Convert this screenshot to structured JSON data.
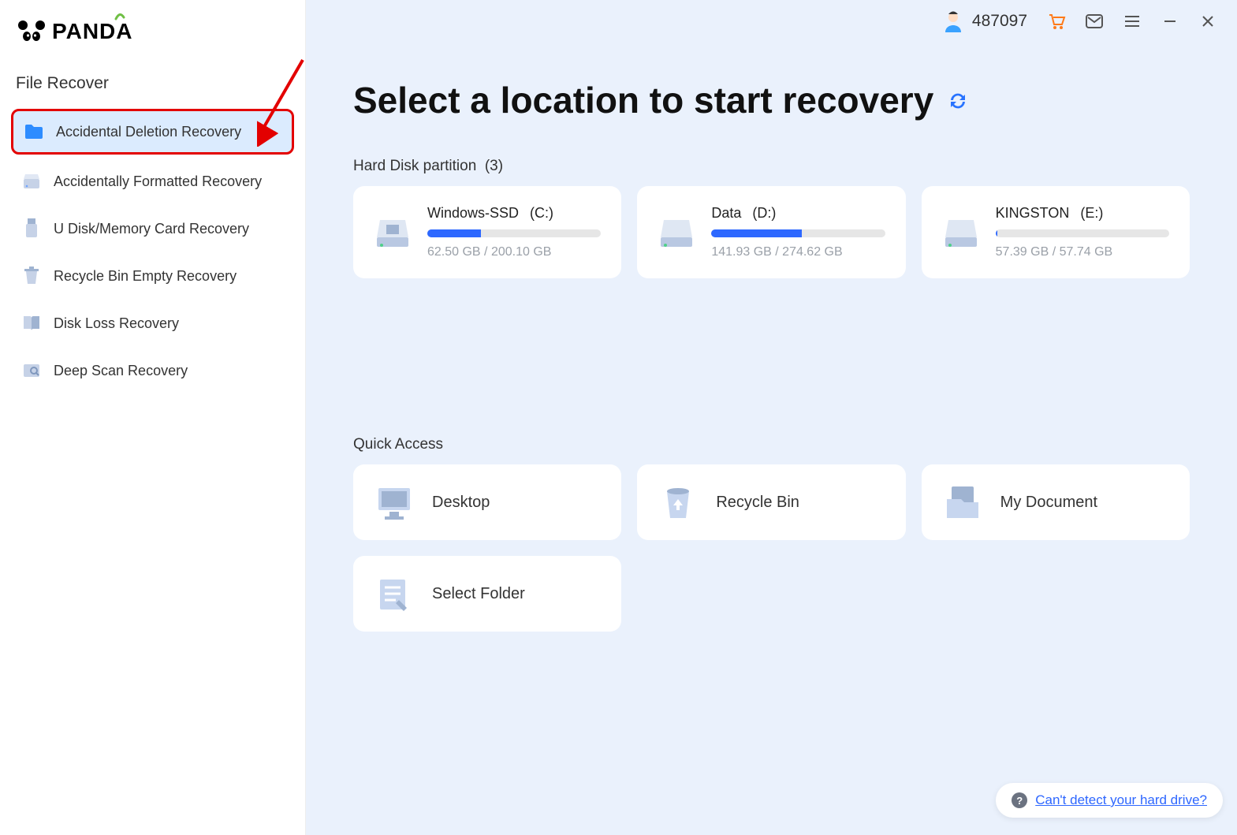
{
  "brand": {
    "name": "PANDA"
  },
  "sidebar": {
    "heading": "File Recover",
    "items": [
      {
        "label": "Accidental Deletion Recovery",
        "icon": "folder-icon",
        "active": true
      },
      {
        "label": "Accidentally Formatted Recovery",
        "icon": "drive-icon",
        "active": false
      },
      {
        "label": "U Disk/Memory Card Recovery",
        "icon": "usb-icon",
        "active": false
      },
      {
        "label": "Recycle Bin Empty Recovery",
        "icon": "trash-icon",
        "active": false
      },
      {
        "label": "Disk Loss Recovery",
        "icon": "book-icon",
        "active": false
      },
      {
        "label": "Deep Scan Recovery",
        "icon": "scan-icon",
        "active": false
      }
    ]
  },
  "titlebar": {
    "user_id": "487097"
  },
  "main": {
    "title": "Select a location to start recovery",
    "partitions_label": "Hard Disk partition",
    "partitions_count": "(3)",
    "partitions": [
      {
        "name": "Windows-SSD",
        "letter": "(C:)",
        "used": "62.50 GB",
        "total": "200.10 GB",
        "size_text": "62.50 GB / 200.10 GB",
        "percent": 31
      },
      {
        "name": "Data",
        "letter": "(D:)",
        "used": "141.93 GB",
        "total": "274.62 GB",
        "size_text": "141.93 GB / 274.62 GB",
        "percent": 52
      },
      {
        "name": "KINGSTON",
        "letter": "(E:)",
        "used": "57.39 GB",
        "total": "57.74 GB",
        "size_text": "57.39 GB / 57.74 GB",
        "percent": 1
      }
    ],
    "quick_label": "Quick Access",
    "quick": [
      {
        "label": "Desktop",
        "icon": "desktop-icon"
      },
      {
        "label": "Recycle Bin",
        "icon": "recycle-icon"
      },
      {
        "label": "My Document",
        "icon": "document-icon"
      },
      {
        "label": "Select Folder",
        "icon": "folder-pick-icon"
      }
    ]
  },
  "help": {
    "text": "Can't detect your hard drive?"
  }
}
